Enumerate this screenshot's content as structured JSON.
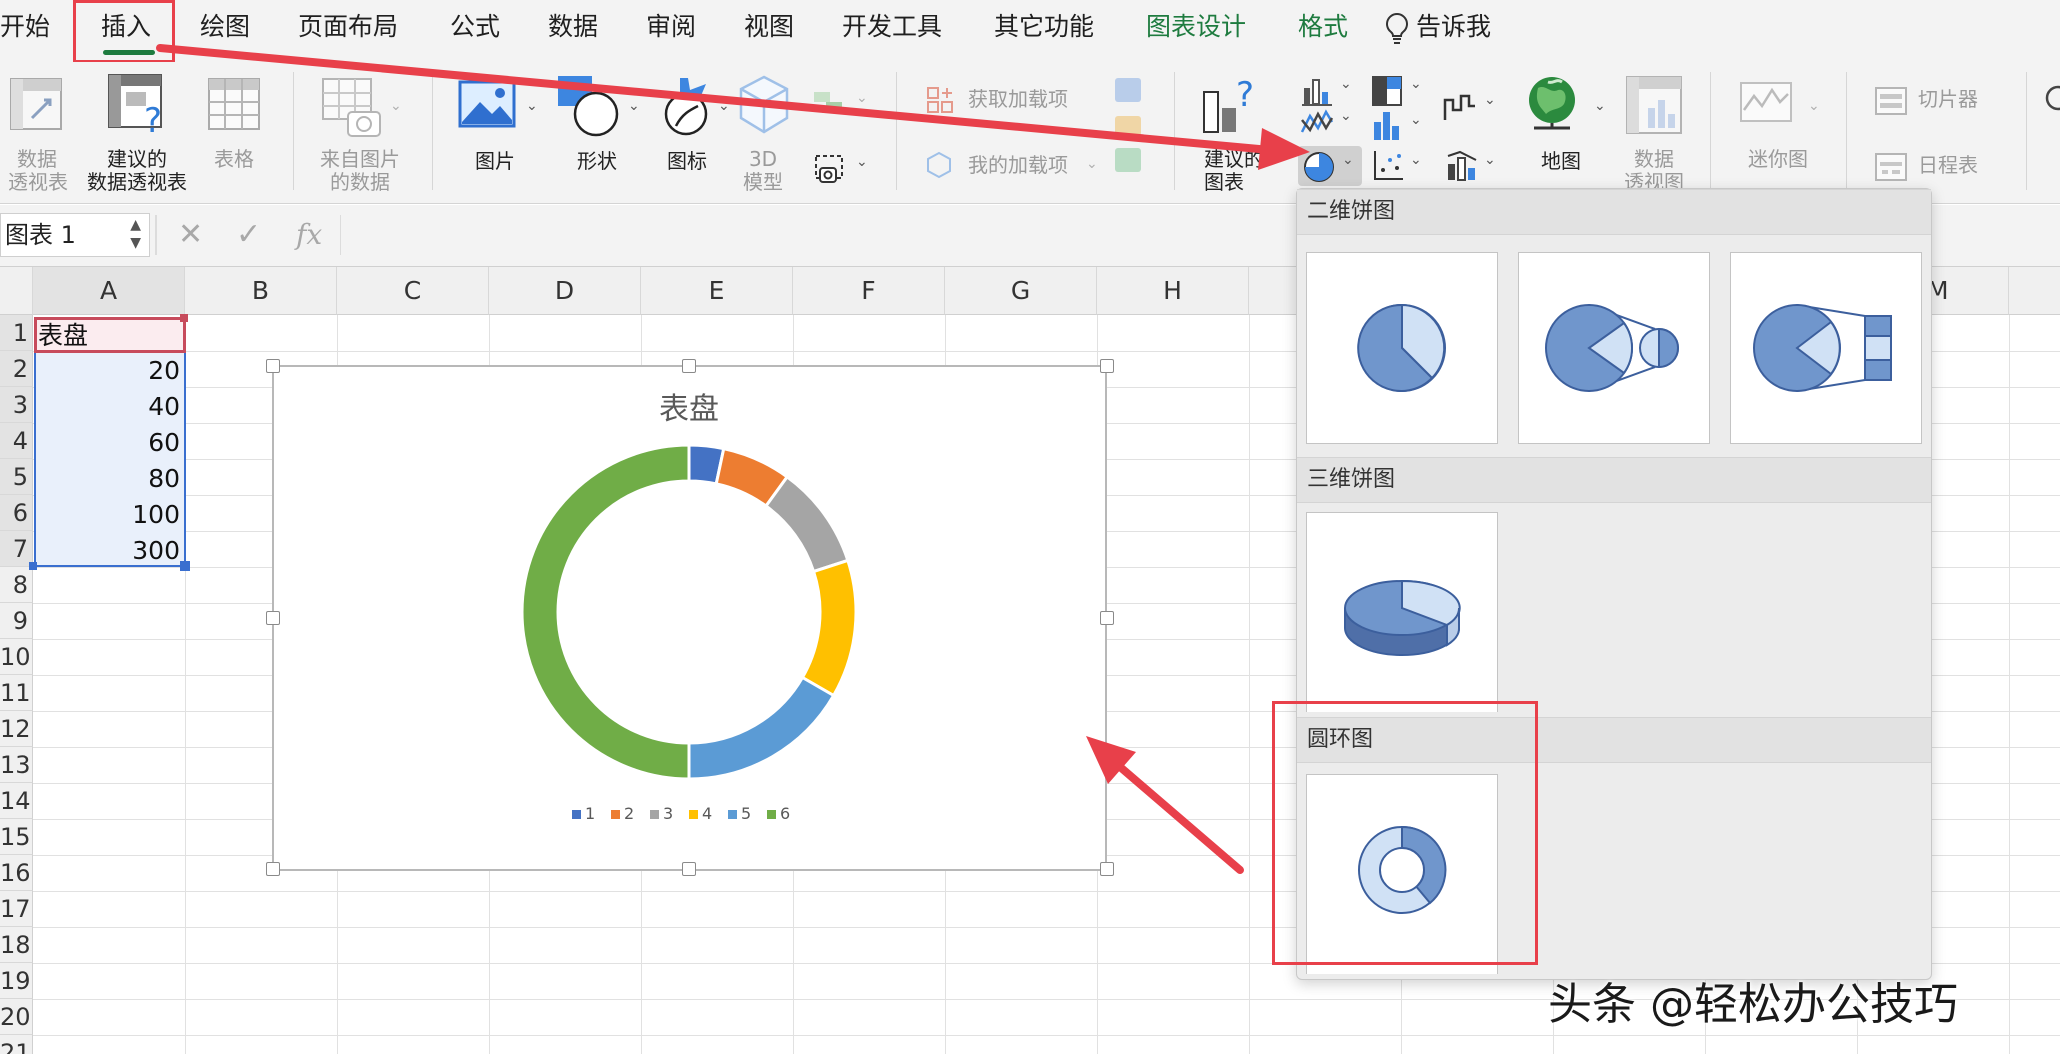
{
  "tabs": [
    {
      "label": "开始"
    },
    {
      "label": "插入"
    },
    {
      "label": "绘图"
    },
    {
      "label": "页面布局"
    },
    {
      "label": "公式"
    },
    {
      "label": "数据"
    },
    {
      "label": "审阅"
    },
    {
      "label": "视图"
    },
    {
      "label": "开发工具"
    },
    {
      "label": "其它功能"
    },
    {
      "label": "图表设计"
    },
    {
      "label": "格式"
    },
    {
      "label": "告诉我"
    }
  ],
  "ribbon": {
    "pivot_l1": "数据",
    "pivot_l2": "透视表",
    "rec_pivot_l1": "建议的",
    "rec_pivot_l2": "数据透视表",
    "table": "表格",
    "from_pic_l1": "来自图片",
    "from_pic_l2": "的数据",
    "pictures": "图片",
    "shapes": "形状",
    "icons": "图标",
    "model3d_l1": "3D",
    "model3d_l2": "模型",
    "get_addins": "获取加载项",
    "my_addins": "我的加载项",
    "rec_chart_l1": "建议的",
    "rec_chart_l2": "图表",
    "map": "地图",
    "pivot_chart_l1": "数据",
    "pivot_chart_l2": "透视图",
    "sparklines": "迷你图",
    "slicer": "切片器",
    "timeline": "日程表"
  },
  "formula_bar": {
    "name_box": "图表 1",
    "fx": "fx"
  },
  "columns": [
    "A",
    "B",
    "C",
    "D",
    "E",
    "F",
    "G",
    "H",
    "M"
  ],
  "rows": [
    "1",
    "2",
    "3",
    "4",
    "5",
    "6",
    "7",
    "8",
    "9",
    "10",
    "11",
    "12",
    "13",
    "14",
    "15",
    "16",
    "17",
    "18",
    "19",
    "20",
    "21"
  ],
  "cells": {
    "a1": "表盘",
    "a2": "20",
    "a3": "40",
    "a4": "60",
    "a5": "80",
    "a6": "100",
    "a7": "300"
  },
  "chart_data": {
    "type": "donut",
    "title": "表盘",
    "categories": [
      "1",
      "2",
      "3",
      "4",
      "5",
      "6"
    ],
    "values": [
      20,
      40,
      60,
      80,
      100,
      300
    ],
    "colors": [
      "#4472c4",
      "#ed7d31",
      "#a5a5a5",
      "#ffc000",
      "#5b9bd5",
      "#70ad47"
    ],
    "legend": "bottom"
  },
  "dropdown": {
    "section_2d": "二维饼图",
    "section_3d": "三维饼图",
    "section_donut": "圆环图"
  },
  "watermark": "头条 @轻松办公技巧",
  "colors": {
    "accent": "#1e7b3f",
    "highlight": "#e8404a"
  }
}
